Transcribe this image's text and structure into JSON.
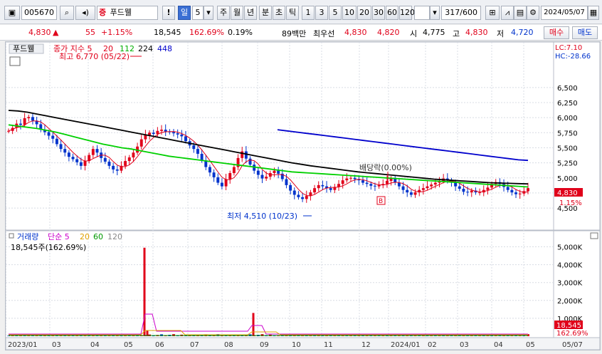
{
  "toolbar": {
    "code": "005670",
    "name": "푸드웰",
    "name_badge": "증",
    "warn": "!",
    "period_selected": "일",
    "period_value": "5",
    "periods": [
      "주",
      "월",
      "년",
      "분",
      "초",
      "틱"
    ],
    "intervals": [
      "1",
      "3",
      "5",
      "10",
      "20",
      "30",
      "60",
      "120"
    ],
    "count": "317/600",
    "date": "2024/05/07"
  },
  "quote": {
    "price": "4,830",
    "change_arrow": "▲",
    "change": "55",
    "change_pct": "+1.15%",
    "volume": "18,545",
    "volume_ratio": "162.69%",
    "turnover": "0.19%",
    "amount": "89백만",
    "best_label": "최우선",
    "best_ask": "4,830",
    "best_bid": "4,820",
    "open_label": "시",
    "open": "4,775",
    "high_label": "고",
    "high": "4,830",
    "low_label": "저",
    "low": "4,720",
    "buy_button": "매수",
    "sell_button": "매도"
  },
  "colors": {
    "up": "#e0001a",
    "down": "#0033cc",
    "ma5": "#e0001a",
    "ma20": "#e0001a",
    "ma112": "#00d000",
    "ma224": "#000000",
    "ma448": "#0000cc",
    "bg": "#ffffff"
  },
  "chart_data": [
    {
      "type": "candlestick",
      "title": "푸드웰",
      "legend": [
        "종가 지수 5",
        "20",
        "112",
        "224",
        "448"
      ],
      "ylim": [
        4300,
        6900
      ],
      "y_ticks": [
        4500,
        4750,
        5000,
        5250,
        5500,
        5750,
        6000,
        6250,
        6500
      ],
      "y_tick_labels": [
        "4,500",
        "4,750",
        "5,000",
        "5,250",
        "5,500",
        "5,750",
        "6,000",
        "6,250",
        "6,500"
      ],
      "x_tick_labels": [
        "2023/01",
        "03",
        "04",
        "05",
        "06",
        "07",
        "08",
        "09",
        "10",
        "11",
        "12",
        "2024/01",
        "02",
        "03",
        "04",
        "05",
        "05/07"
      ],
      "price_lc": "LC:7.10",
      "price_hc": "HC:-28.66",
      "current_price_label": "4,830",
      "current_change_label": "1.15%",
      "annotations": {
        "high": "최고 6,770 (05/22)",
        "low": "최저 4,510 (10/23)",
        "dividend": "배당락(0.00%)",
        "marker": "B"
      },
      "close": [
        5780,
        5830,
        5900,
        5880,
        5990,
        6010,
        5950,
        5890,
        5800,
        5760,
        5700,
        5650,
        5560,
        5480,
        5420,
        5350,
        5310,
        5260,
        5200,
        5280,
        5380,
        5480,
        5420,
        5330,
        5270,
        5200,
        5140,
        5120,
        5200,
        5280,
        5340,
        5420,
        5520,
        5640,
        5710,
        5750,
        5730,
        5780,
        5800,
        5770,
        5760,
        5740,
        5720,
        5690,
        5610,
        5540,
        5480,
        5400,
        5290,
        5180,
        5090,
        5010,
        4920,
        4860,
        4980,
        5080,
        5180,
        5330,
        5440,
        5320,
        5220,
        5120,
        5050,
        4990,
        5020,
        5080,
        5120,
        5070,
        4980,
        4880,
        4790,
        4720,
        4680,
        4650,
        4700,
        4760,
        4830,
        4880,
        4860,
        4830,
        4800,
        4850,
        4900,
        4960,
        4990,
        5000,
        4980,
        4960,
        4920,
        4900,
        4870,
        4860,
        4880,
        4900,
        4950,
        4990,
        4920,
        4860,
        4800,
        4760,
        4720,
        4760,
        4800,
        4830,
        4860,
        4890,
        4920,
        4950,
        4990,
        4960,
        4920,
        4860,
        4820,
        4770,
        4760,
        4790,
        4760,
        4760,
        4800,
        4840,
        4900,
        4930,
        4900,
        4850,
        4800,
        4760,
        4730,
        4740,
        4780,
        4830
      ],
      "ma112": [
        5880,
        5860,
        5840,
        5820,
        5790,
        5760,
        5720,
        5680,
        5640,
        5600,
        5560,
        5530,
        5500,
        5480,
        5450,
        5420,
        5390,
        5360,
        5340,
        5320,
        5300,
        5280,
        5260,
        5240,
        5220,
        5200,
        5180,
        5160,
        5140,
        5120,
        5100,
        5090,
        5080,
        5070,
        5060,
        5050,
        5040,
        5030,
        5020,
        5010,
        5000,
        4990,
        4980,
        4970,
        4960,
        4950,
        4940,
        4930,
        4920,
        4910,
        4900,
        4890,
        4880,
        4870,
        4860,
        4850
      ],
      "ma224": [
        6120,
        6110,
        6090,
        6060,
        6030,
        6000,
        5970,
        5940,
        5910,
        5880,
        5850,
        5820,
        5790,
        5760,
        5730,
        5700,
        5670,
        5640,
        5610,
        5580,
        5550,
        5520,
        5490,
        5460,
        5430,
        5400,
        5370,
        5340,
        5310,
        5280,
        5250,
        5225,
        5200,
        5180,
        5160,
        5140,
        5120,
        5100,
        5085,
        5070,
        5055,
        5040,
        5025,
        5010,
        4995,
        4980,
        4970,
        4960,
        4950,
        4940,
        4930,
        4920,
        4915,
        4910,
        4905,
        4900
      ],
      "ma448": [
        5800,
        5780,
        5760,
        5740,
        5720,
        5700,
        5680,
        5660,
        5640,
        5620,
        5600,
        5580,
        5560,
        5540,
        5520,
        5500,
        5480,
        5460,
        5440,
        5420,
        5400,
        5380,
        5360,
        5340,
        5320,
        5300,
        5290
      ]
    },
    {
      "type": "bar",
      "title": "거래량",
      "legend": [
        "거래량",
        "단순 5",
        "20",
        "60",
        "120"
      ],
      "ylim": [
        0,
        5300000
      ],
      "y_ticks": [
        1000000,
        2000000,
        3000000,
        4000000,
        5000000
      ],
      "y_tick_labels": [
        "1,000K",
        "2,000K",
        "3,000K",
        "4,000K",
        "5,000K"
      ],
      "current_label": "18,545주(162.69%)",
      "current_value_label": "18,545",
      "current_ratio_label": "162.69%",
      "spikes": [
        {
          "label": "05/22",
          "value": 4950000
        },
        {
          "label": "08/28",
          "value": 1300000
        },
        {
          "label": "05/23",
          "value": 300000
        }
      ]
    }
  ]
}
